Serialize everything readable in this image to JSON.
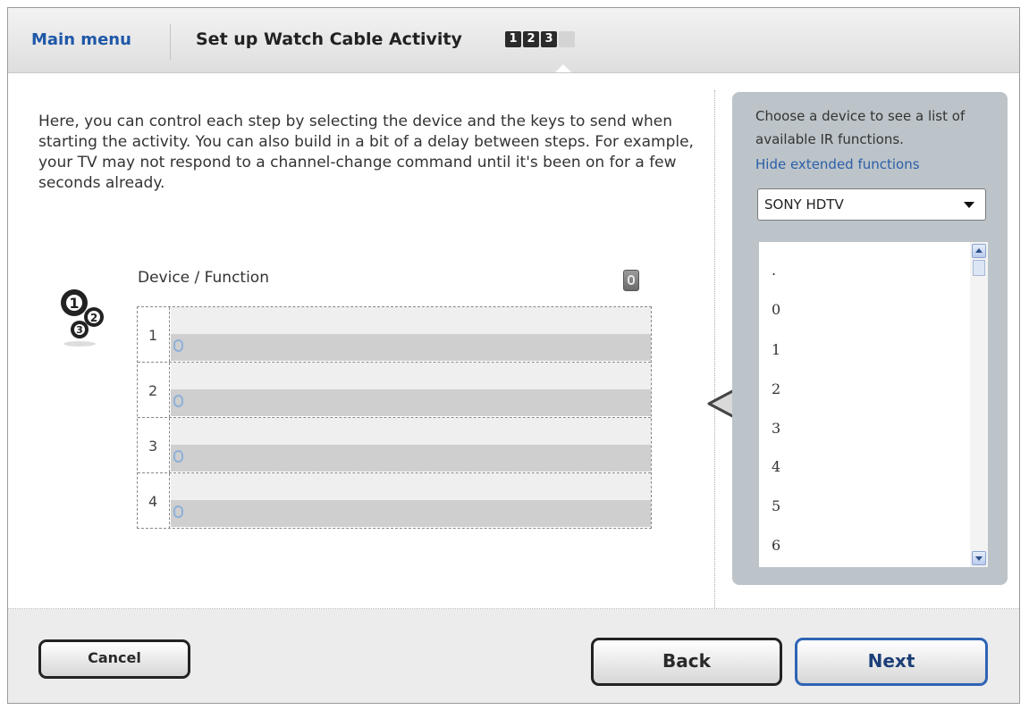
{
  "header": {
    "main_menu": "Main menu",
    "title": "Set up Watch Cable Activity",
    "steps": [
      "1",
      "2",
      "3",
      ""
    ]
  },
  "description": "Here, you can control each step by selecting the device and the keys to send when starting the activity. You can also build in a bit of a delay between steps. For example, your TV may not respond to a channel-change command until it's been on for a few seconds already.",
  "table": {
    "column_label": "Device / Function",
    "rows": [
      "1",
      "2",
      "3",
      "4"
    ]
  },
  "panel": {
    "instructions": "Choose a device to see a list of available IR functions.",
    "extended_link": "Hide extended functions",
    "device_selected": "SONY HDTV",
    "functions": [
      ".",
      "0",
      "1",
      "2",
      "3",
      "4",
      "5",
      "6"
    ]
  },
  "buttons": {
    "cancel": "Cancel",
    "back": "Back",
    "next": "Next"
  },
  "icons": {
    "gears": "numbered-gears-icon",
    "trash": "trash-icon",
    "add_arrow": "left-arrow-icon"
  }
}
